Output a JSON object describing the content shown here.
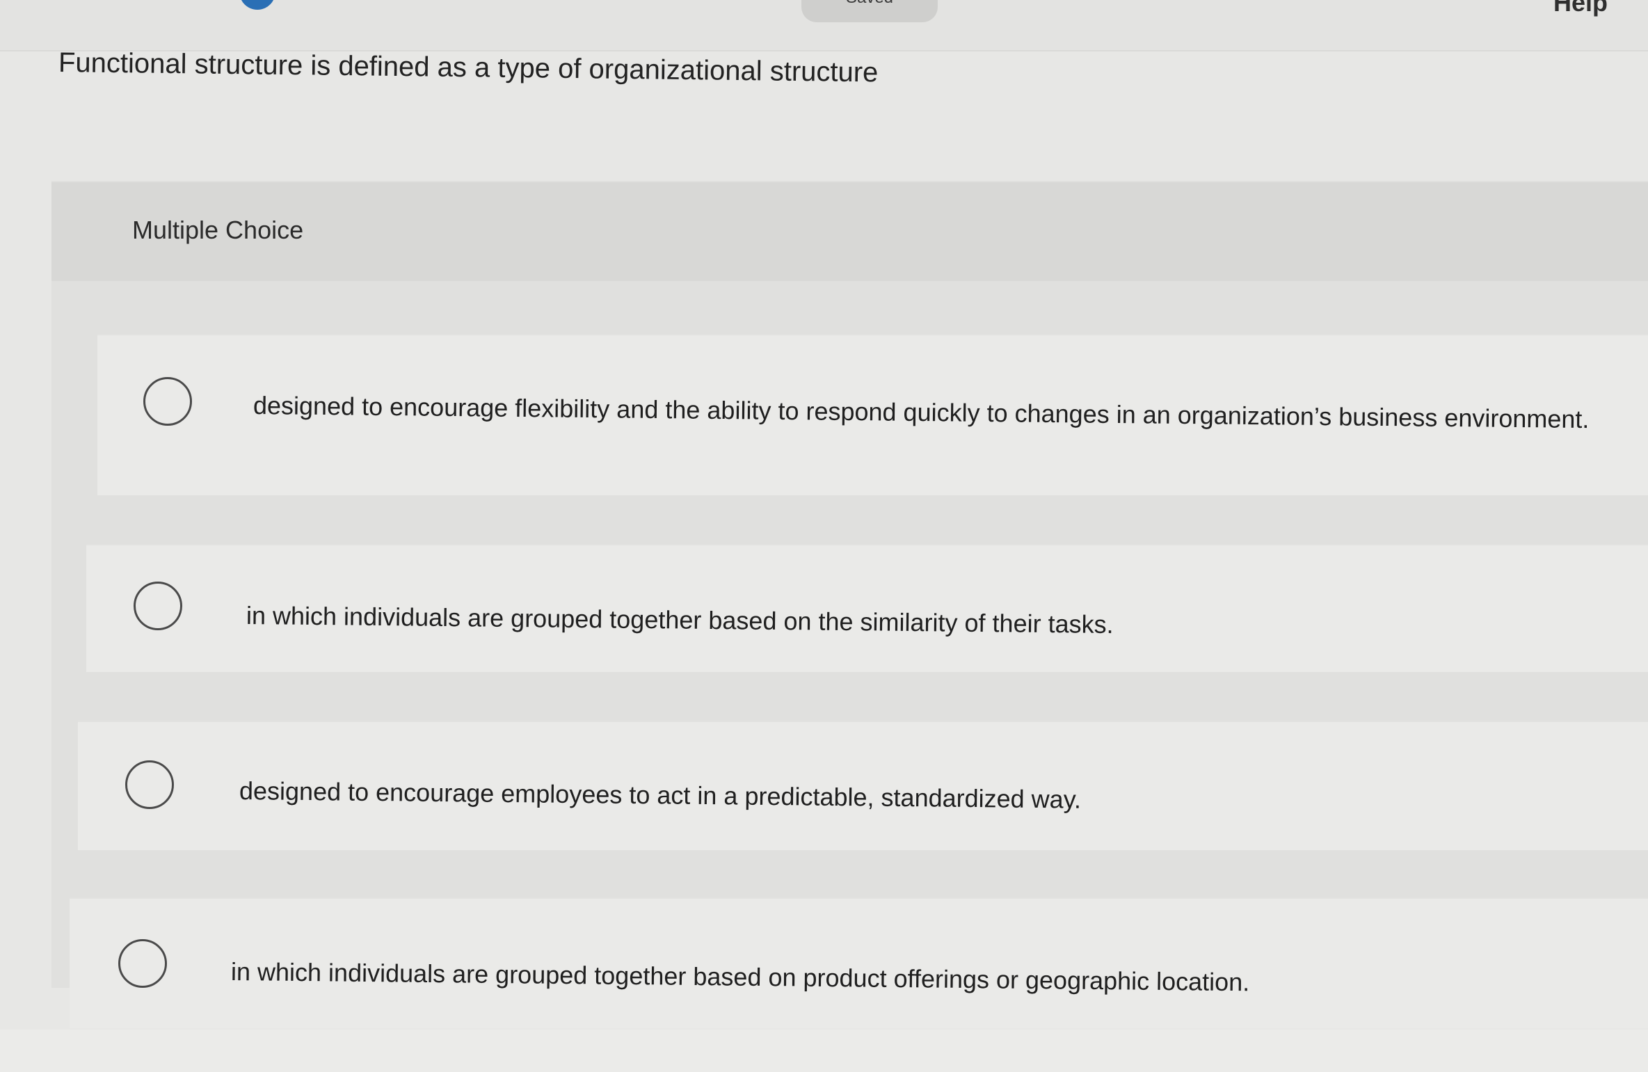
{
  "header": {
    "saved_label": "Saved",
    "help_label": "Help"
  },
  "question": {
    "text": "Functional structure is defined as a type of organizational structure"
  },
  "mc": {
    "label": "Multiple Choice",
    "options": [
      {
        "text": "designed to encourage flexibility and the ability to respond quickly to changes in an organization’s business environment."
      },
      {
        "text": "in which individuals are grouped together based on the similarity of their tasks."
      },
      {
        "text": "designed to encourage employees to act in a predictable, standardized way."
      },
      {
        "text": "in which individuals are grouped together based on product offerings or geographic location."
      }
    ]
  }
}
